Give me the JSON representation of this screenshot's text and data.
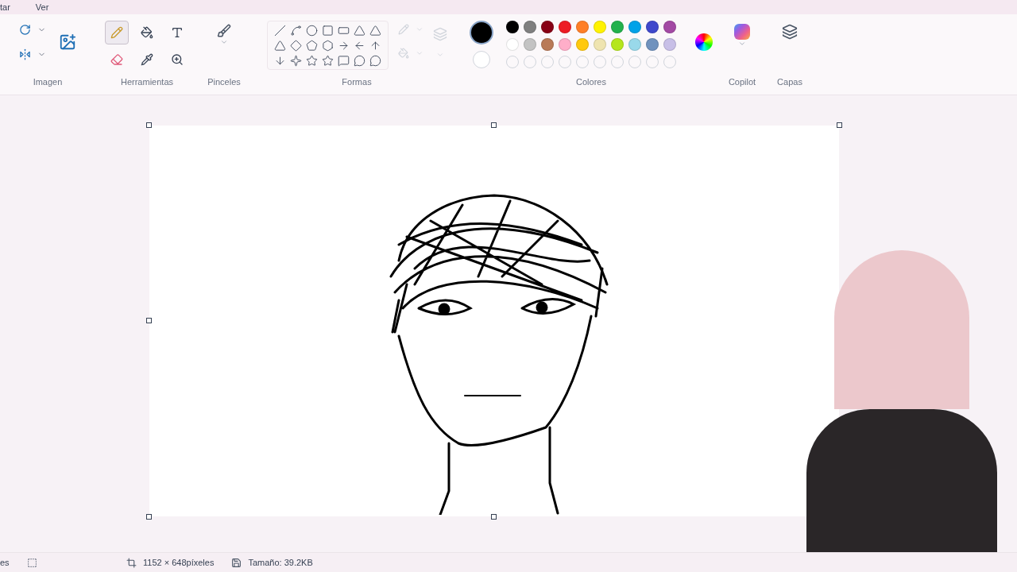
{
  "menu": [
    "tar",
    "Ver"
  ],
  "tools": [
    {
      "kind": "pencil",
      "selected": true
    },
    {
      "kind": "fill",
      "selected": false
    },
    {
      "kind": "text",
      "selected": false
    },
    {
      "kind": "eraser",
      "selected": false
    },
    {
      "kind": "picker",
      "selected": false
    },
    {
      "kind": "zoom",
      "selected": false
    }
  ],
  "groups": {
    "image": "Imagen",
    "tools": "Herramientas",
    "brushes": "Pinceles",
    "shapes": "Formas",
    "colors": "Colores",
    "copilot": "Copilot",
    "layers": "Capas"
  },
  "current_colors": [
    {
      "color": "#000000",
      "selected": true
    },
    {
      "color": "#ffffff",
      "selected": false
    }
  ],
  "swatches": [
    {
      "kind": "color",
      "color": "#000000"
    },
    {
      "kind": "color",
      "color": "#7f7f7f"
    },
    {
      "kind": "color",
      "color": "#880015"
    },
    {
      "kind": "color",
      "color": "#ed1c24"
    },
    {
      "kind": "color",
      "color": "#ff7f27"
    },
    {
      "kind": "color",
      "color": "#fff200"
    },
    {
      "kind": "color",
      "color": "#22b14c"
    },
    {
      "kind": "color",
      "color": "#00a2e8"
    },
    {
      "kind": "color",
      "color": "#3f48cc"
    },
    {
      "kind": "color",
      "color": "#a349a4"
    },
    {
      "kind": "color",
      "color": "#ffffff"
    },
    {
      "kind": "color",
      "color": "#c3c3c3"
    },
    {
      "kind": "color",
      "color": "#b97a57"
    },
    {
      "kind": "color",
      "color": "#ffaec9"
    },
    {
      "kind": "color",
      "color": "#ffc90e"
    },
    {
      "kind": "color",
      "color": "#efe4b0"
    },
    {
      "kind": "color",
      "color": "#b5e61d"
    },
    {
      "kind": "color",
      "color": "#99d9ea"
    },
    {
      "kind": "color",
      "color": "#7092be"
    },
    {
      "kind": "color",
      "color": "#c8bfe7"
    },
    {
      "kind": "empty"
    },
    {
      "kind": "empty"
    },
    {
      "kind": "empty"
    },
    {
      "kind": "empty"
    },
    {
      "kind": "empty"
    },
    {
      "kind": "empty"
    },
    {
      "kind": "empty"
    },
    {
      "kind": "empty"
    },
    {
      "kind": "empty"
    },
    {
      "kind": "empty"
    }
  ],
  "status_bar": {
    "left": "es",
    "dimensions": "1152 × 648píxeles",
    "size": "Tamaño: 39.2KB"
  }
}
